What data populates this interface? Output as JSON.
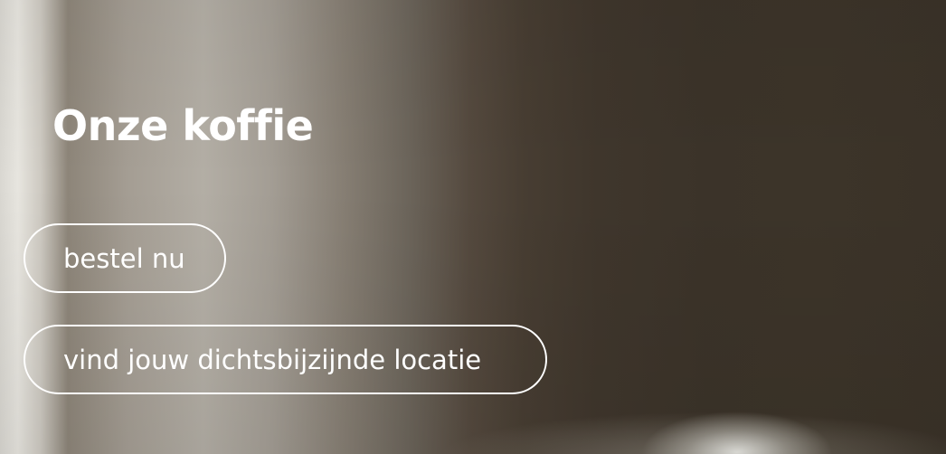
{
  "hero": {
    "title": "Onze koffie",
    "order_button_label": "bestel nu",
    "location_button_label": "vind jouw dichtsbijzijnde locatie"
  },
  "colors": {
    "text": "#ffffff",
    "button_border": "#ffffff",
    "background_dark": "#3c3429",
    "background_light": "#e7e5df"
  }
}
